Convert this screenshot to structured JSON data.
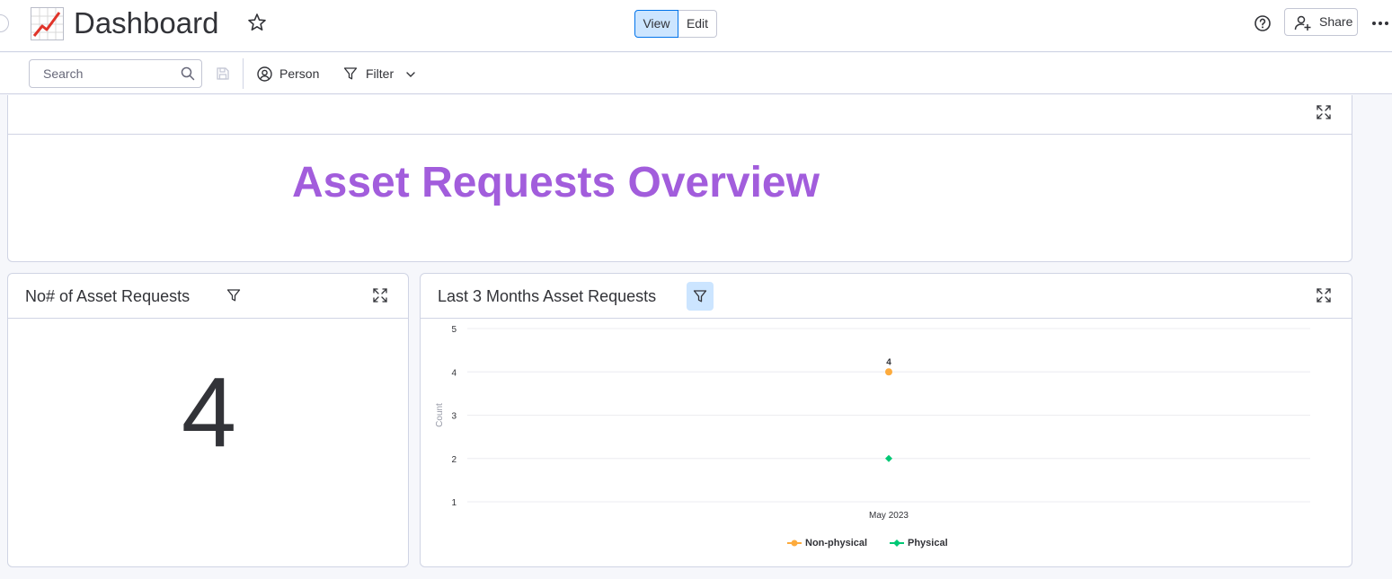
{
  "header": {
    "title": "Dashboard",
    "view_label": "View",
    "edit_label": "Edit",
    "share_label": "Share"
  },
  "toolbar": {
    "search_placeholder": "Search",
    "person_label": "Person",
    "filter_label": "Filter"
  },
  "overview": {
    "title": "Asset Requests Overview",
    "title_color": "#a25ddc"
  },
  "count_widget": {
    "title": "No# of Asset Requests",
    "value": "4"
  },
  "chart_widget": {
    "title": "Last 3 Months Asset Requests"
  },
  "chart_data": {
    "type": "scatter",
    "title": "Last 3 Months Asset Requests",
    "xlabel": "",
    "ylabel": "Count",
    "categories": [
      "May 2023"
    ],
    "ylim": [
      1,
      5
    ],
    "yticks": [
      1,
      2,
      3,
      4,
      5
    ],
    "grid": true,
    "legend": "bottom",
    "series": [
      {
        "name": "Non-physical",
        "values": [
          4
        ],
        "color": "#fdab3d",
        "marker": "circle",
        "data_label": "4"
      },
      {
        "name": "Physical",
        "values": [
          2
        ],
        "color": "#00c875",
        "marker": "diamond"
      }
    ]
  }
}
